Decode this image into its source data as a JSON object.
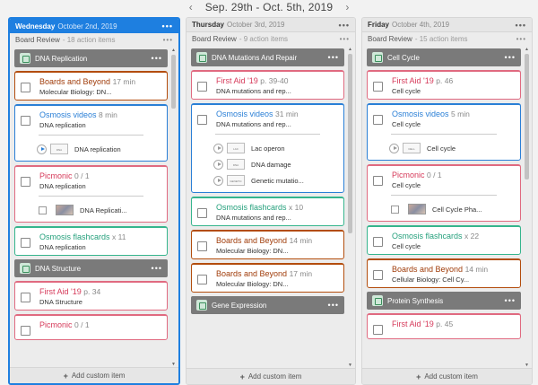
{
  "header": {
    "range": "Sep. 29th - Oct. 5th, 2019",
    "prev_arrow": "‹",
    "next_arrow": "›"
  },
  "add_label": "Add custom item",
  "columns": [
    {
      "day": "Wednesday",
      "date": "October 2nd, 2019",
      "menu": "•••",
      "board": "Board Review",
      "count": "- 18 action items",
      "section1": "DNA Replication",
      "c1": {
        "title": "Boards and Beyond",
        "meta": "17 min",
        "sub": "Molecular Biology: DN..."
      },
      "c2": {
        "title": "Osmosis videos",
        "meta": "8 min",
        "sub": "DNA replication",
        "thumb": "DNA REPLICATION",
        "item": "DNA replication"
      },
      "c3": {
        "title": "Picmonic",
        "meta": "0 / 1",
        "sub": "DNA replication",
        "item": "DNA Replicati..."
      },
      "c4": {
        "title": "Osmosis flashcards",
        "meta": "x 11",
        "sub": "DNA replication"
      },
      "section2": "DNA Structure",
      "c5": {
        "title": "First Aid '19",
        "meta": "p. 34",
        "sub": "DNA Structure"
      },
      "c6": {
        "title": "Picmonic",
        "meta": "0 / 1"
      }
    },
    {
      "day": "Thursday",
      "date": "October 3rd, 2019",
      "menu": "•••",
      "board": "Board Review",
      "count": "- 9 action items",
      "section1": "DNA Mutations And Repair",
      "c1": {
        "title": "First Aid '19",
        "meta": "p. 39-40",
        "sub": "DNA mutations and rep..."
      },
      "c2": {
        "title": "Osmosis videos",
        "meta": "31 min",
        "sub": "DNA mutations and rep...",
        "items": [
          {
            "thumb": "LAC OPERON",
            "label": "Lac operon"
          },
          {
            "thumb": "DNA DAMAGE",
            "label": "DNA damage"
          },
          {
            "thumb": "GENETIC MUT",
            "label": "Genetic mutatio..."
          }
        ]
      },
      "c3": {
        "title": "Osmosis flashcards",
        "meta": "x 10",
        "sub": "DNA mutations and rep..."
      },
      "c4": {
        "title": "Boards and Beyond",
        "meta": "14 min",
        "sub": "Molecular Biology: DN..."
      },
      "c5": {
        "title": "Boards and Beyond",
        "meta": "17 min",
        "sub": "Molecular Biology: DN..."
      },
      "section2": "Gene Expression"
    },
    {
      "day": "Friday",
      "date": "October 4th, 2019",
      "menu": "•••",
      "board": "Board Review",
      "count": "- 15 action items",
      "section1": "Cell Cycle",
      "c1": {
        "title": "First Aid '19",
        "meta": "p. 46",
        "sub": "Cell cycle"
      },
      "c2": {
        "title": "Osmosis videos",
        "meta": "5 min",
        "sub": "Cell cycle",
        "thumb": "CELL CYCLE",
        "item": "Cell cycle"
      },
      "c3": {
        "title": "Picmonic",
        "meta": "0 / 1",
        "sub": "Cell cycle",
        "item": "Cell Cycle Pha..."
      },
      "c4": {
        "title": "Osmosis flashcards",
        "meta": "x 22",
        "sub": "Cell cycle"
      },
      "c5": {
        "title": "Boards and Beyond",
        "meta": "14 min",
        "sub": "Cellular Biology: Cell Cy..."
      },
      "section2": "Protein Synthesis",
      "c6": {
        "title": "First Aid '19",
        "meta": "p. 45"
      }
    }
  ]
}
